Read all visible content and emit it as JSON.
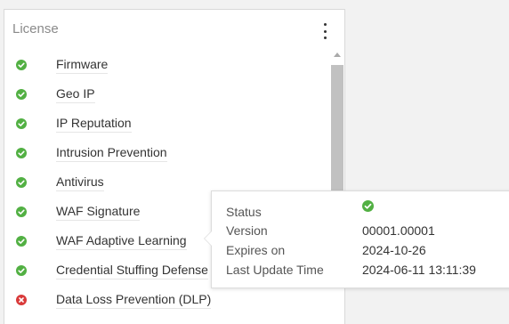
{
  "panel": {
    "title": "License",
    "menu_icon": "kebab-menu-icon"
  },
  "colors": {
    "ok": "#52b043",
    "error": "#d93a3a"
  },
  "licenses": [
    {
      "label": "Firmware",
      "status": "ok"
    },
    {
      "label": "Geo IP",
      "status": "ok"
    },
    {
      "label": "IP Reputation",
      "status": "ok"
    },
    {
      "label": "Intrusion Prevention",
      "status": "ok"
    },
    {
      "label": "Antivirus",
      "status": "ok"
    },
    {
      "label": "WAF Signature",
      "status": "ok"
    },
    {
      "label": "WAF Adaptive Learning",
      "status": "ok"
    },
    {
      "label": "Credential Stuffing Defense",
      "status": "ok"
    },
    {
      "label": "Data Loss Prevention (DLP)",
      "status": "error"
    }
  ],
  "tooltip": {
    "status_label": "Status",
    "status_icon": "check-circle-icon",
    "version_label": "Version",
    "version_value": "00001.00001",
    "expires_label": "Expires on",
    "expires_value": "2024-10-26",
    "update_label": "Last Update Time",
    "update_value": "2024-06-11 13:11:39"
  }
}
